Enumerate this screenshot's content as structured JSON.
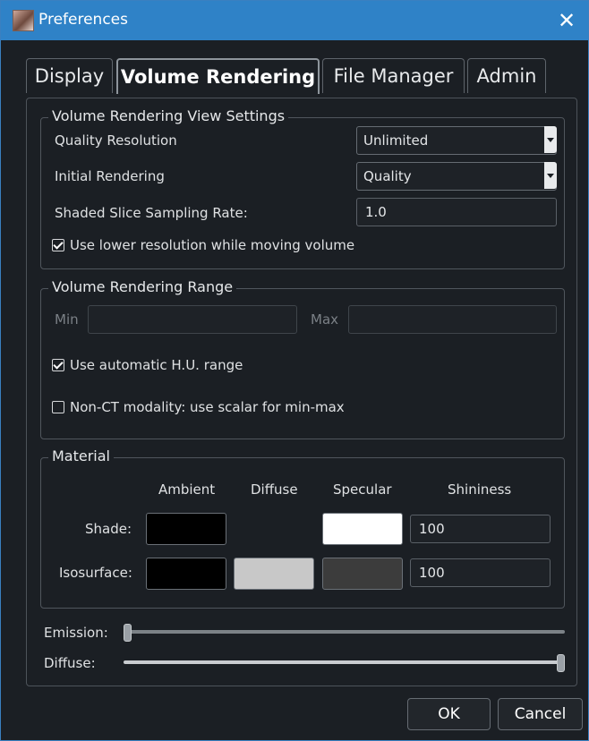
{
  "window": {
    "title": "Preferences"
  },
  "tabs": [
    "Display",
    "Volume Rendering",
    "File Manager",
    "Admin"
  ],
  "active_tab": "Volume Rendering",
  "view_settings": {
    "title": "Volume Rendering View Settings",
    "quality_resolution": {
      "label": "Quality Resolution",
      "value": "Unlimited"
    },
    "initial_rendering": {
      "label": "Initial Rendering",
      "value": "Quality"
    },
    "sampling_rate": {
      "label": "Shaded Slice Sampling Rate:",
      "value": "1.0"
    },
    "lower_res_moving": {
      "label": "Use lower resolution while moving volume",
      "checked": true
    }
  },
  "range": {
    "title": "Volume Rendering Range",
    "min_label": "Min",
    "max_label": "Max",
    "min_value": "",
    "max_value": "",
    "auto_hu": {
      "label": "Use automatic H.U. range",
      "checked": true
    },
    "non_ct": {
      "label": "Non-CT modality: use scalar for min-max",
      "checked": false
    }
  },
  "material": {
    "title": "Material",
    "columns": [
      "Ambient",
      "Diffuse",
      "Specular",
      "Shininess"
    ],
    "rows": [
      {
        "label": "Shade:",
        "ambient": "#000000",
        "diffuse": null,
        "specular": "#ffffff",
        "shininess": "100"
      },
      {
        "label": "Isosurface:",
        "ambient": "#000000",
        "diffuse": "#c8c8c8",
        "specular": "#3c3c3c",
        "shininess": "100"
      }
    ]
  },
  "sliders": {
    "emission": {
      "label": "Emission:",
      "fraction": 0.0
    },
    "diffuse": {
      "label": "Diffuse:",
      "fraction": 1.0
    }
  },
  "buttons": {
    "ok": "OK",
    "cancel": "Cancel"
  },
  "colors": {
    "titlebar": "#2f82c7",
    "background": "#1b1f24"
  }
}
